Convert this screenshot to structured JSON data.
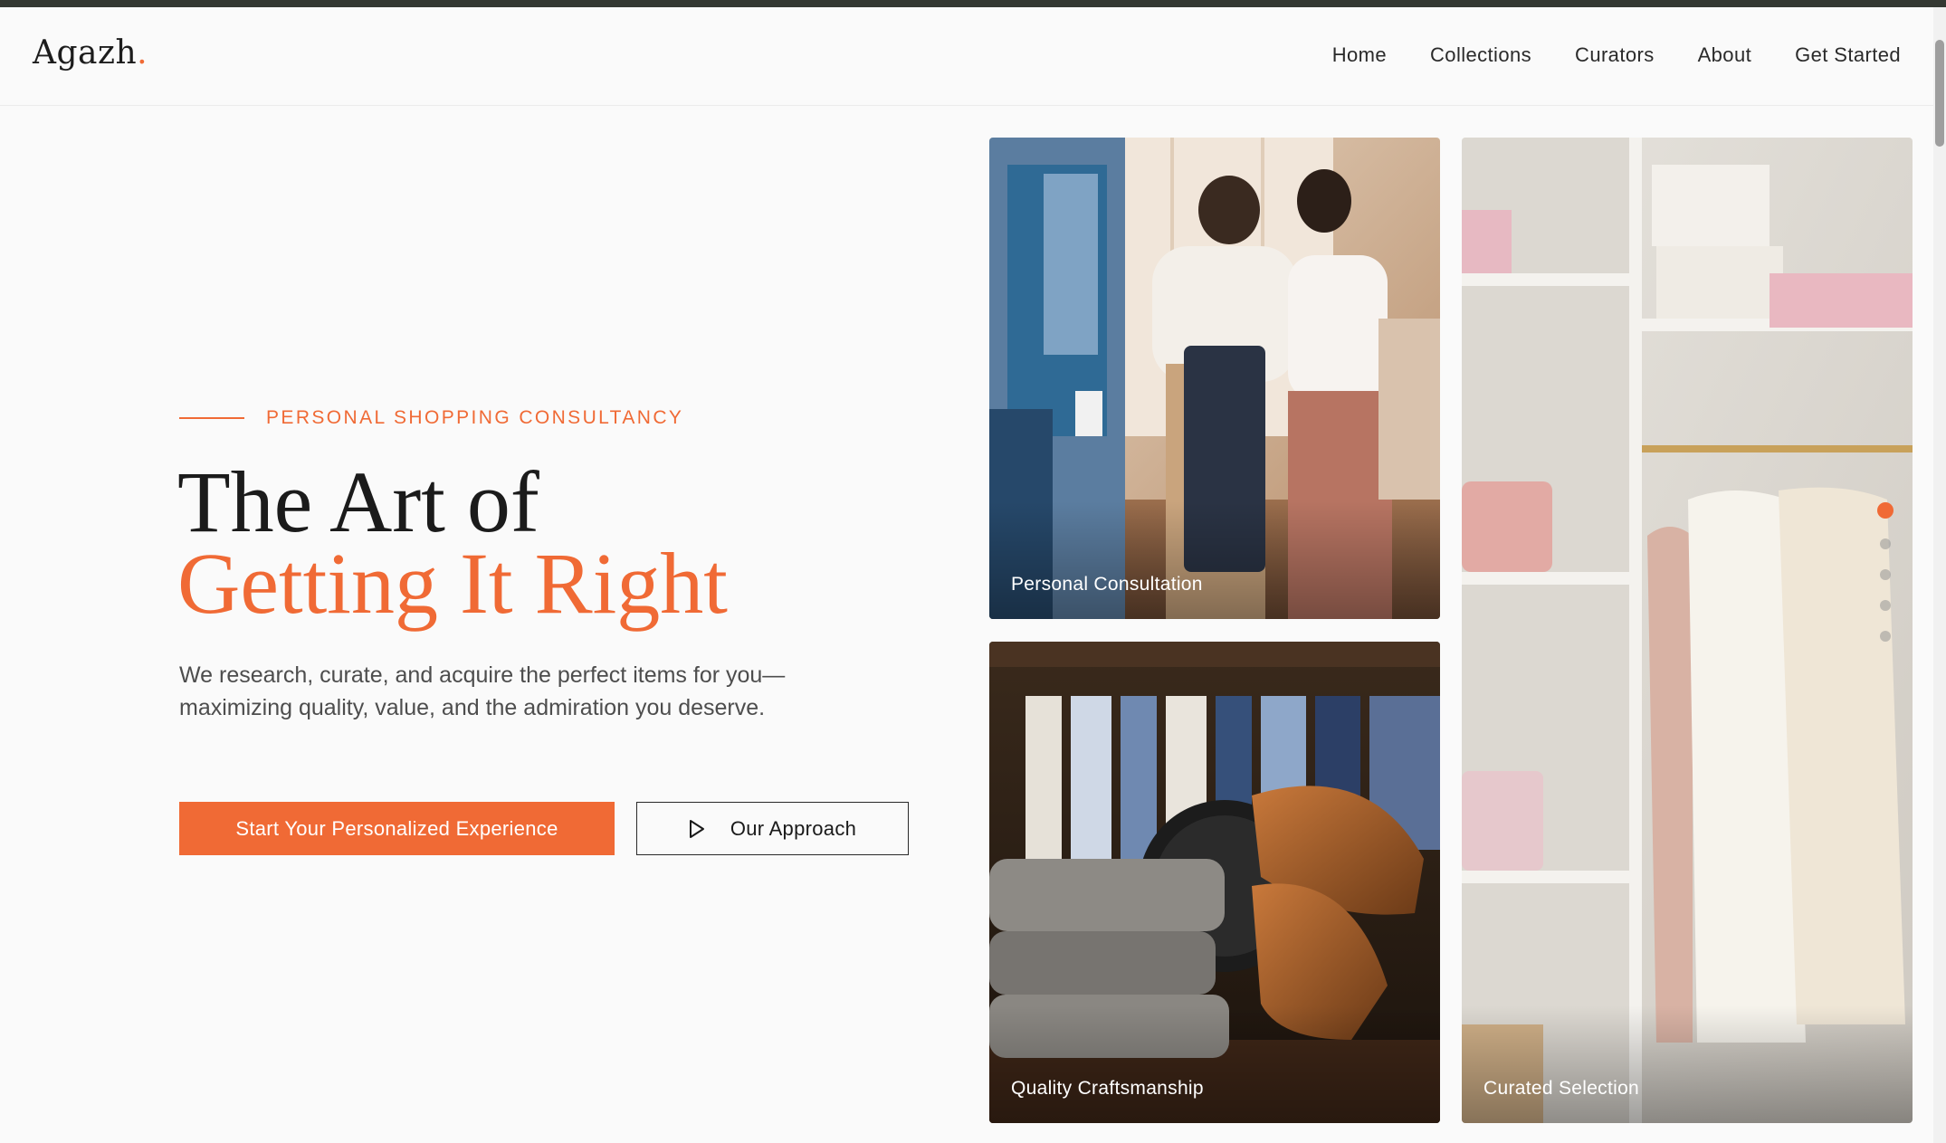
{
  "brand": {
    "name": "Agazh",
    "dot": "."
  },
  "nav": {
    "items": [
      {
        "label": "Home"
      },
      {
        "label": "Collections"
      },
      {
        "label": "Curators"
      },
      {
        "label": "About"
      },
      {
        "label": "Get Started"
      }
    ]
  },
  "hero": {
    "eyebrow": "PERSONAL SHOPPING CONSULTANCY",
    "headline_line1": "The Art of",
    "headline_line2": "Getting It Right",
    "description": "We research, curate, and acquire the perfect items for you—maximizing quality, value, and the admiration you deserve.",
    "primary_cta": "Start Your Personalized Experience",
    "secondary_cta": "Our Approach"
  },
  "gallery": {
    "cards": [
      {
        "caption": "Personal Consultation",
        "scene": "clothing-store-consultation"
      },
      {
        "caption": "Quality Craftsmanship",
        "scene": "leather-shoes-and-knitwear"
      },
      {
        "caption": "Curated Selection",
        "scene": "white-wardrobe-shelves"
      }
    ],
    "slider": {
      "dot_count": 5,
      "active_index": 0
    }
  },
  "colors": {
    "accent": "#f06a35",
    "text": "#1b1b1b",
    "muted_text": "#4d4d4d",
    "background": "#fafafa",
    "top_strip": "#343832"
  },
  "icons": {
    "play": "play-triangle-outline"
  }
}
